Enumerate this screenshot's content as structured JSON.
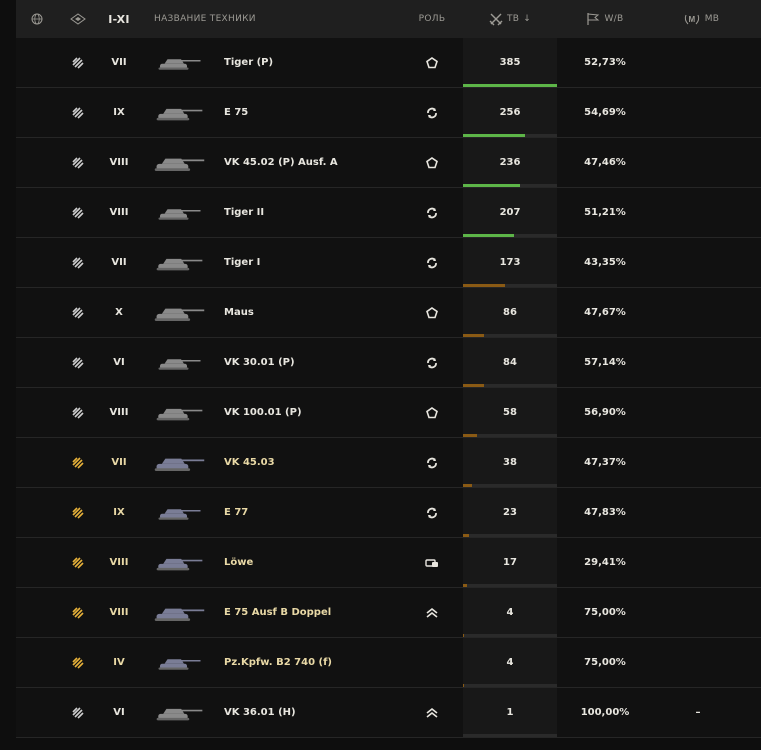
{
  "header": {
    "nation_icon": "globe-icon",
    "type_icon": "vehicle-type-icon",
    "tier_label": "I-XI",
    "name_label": "НАЗВАНИЕ ТЕХНИКИ",
    "role_label": "РОЛЬ",
    "battles_label": "ТВ",
    "sort_indicator": "↓",
    "winrate_label": "W/B",
    "mastery_label": "MB"
  },
  "colors": {
    "bar_green": "#5db548",
    "bar_orange": "#8a5a14",
    "premium_gold": "#e8b23a",
    "regular_chevron": "#cfcfcf"
  },
  "rows": [
    {
      "tier": "VII",
      "name": "Tiger (P)",
      "role": "pentagon-icon",
      "battles": "385",
      "winrate": "52,73%",
      "mb": "",
      "bar": 1.0,
      "bar_color": "green",
      "premium": false
    },
    {
      "tier": "IX",
      "name": "E 75",
      "role": "cycle-icon",
      "battles": "256",
      "winrate": "54,69%",
      "mb": "",
      "bar": 0.66,
      "bar_color": "green",
      "premium": false
    },
    {
      "tier": "VIII",
      "name": "VK 45.02 (P) Ausf. A",
      "role": "pentagon-icon",
      "battles": "236",
      "winrate": "47,46%",
      "mb": "",
      "bar": 0.61,
      "bar_color": "green",
      "premium": false
    },
    {
      "tier": "VIII",
      "name": "Tiger II",
      "role": "cycle-icon",
      "battles": "207",
      "winrate": "51,21%",
      "mb": "",
      "bar": 0.54,
      "bar_color": "green",
      "premium": false
    },
    {
      "tier": "VII",
      "name": "Tiger I",
      "role": "cycle-icon",
      "battles": "173",
      "winrate": "43,35%",
      "mb": "",
      "bar": 0.45,
      "bar_color": "orange",
      "premium": false
    },
    {
      "tier": "X",
      "name": "Maus",
      "role": "pentagon-icon",
      "battles": "86",
      "winrate": "47,67%",
      "mb": "",
      "bar": 0.22,
      "bar_color": "orange",
      "premium": false
    },
    {
      "tier": "VI",
      "name": "VK 30.01 (P)",
      "role": "cycle-icon",
      "battles": "84",
      "winrate": "57,14%",
      "mb": "",
      "bar": 0.22,
      "bar_color": "orange",
      "premium": false
    },
    {
      "tier": "VIII",
      "name": "VK 100.01 (P)",
      "role": "pentagon-icon",
      "battles": "58",
      "winrate": "56,90%",
      "mb": "",
      "bar": 0.15,
      "bar_color": "orange",
      "premium": false
    },
    {
      "tier": "VII",
      "name": "VK 45.03",
      "role": "cycle-icon",
      "battles": "38",
      "winrate": "47,37%",
      "mb": "",
      "bar": 0.1,
      "bar_color": "orange",
      "premium": true
    },
    {
      "tier": "IX",
      "name": "E 77",
      "role": "cycle-icon",
      "battles": "23",
      "winrate": "47,83%",
      "mb": "",
      "bar": 0.06,
      "bar_color": "orange",
      "premium": true
    },
    {
      "tier": "VIII",
      "name": "Löwe",
      "role": "shield-icon",
      "battles": "17",
      "winrate": "29,41%",
      "mb": "",
      "bar": 0.04,
      "bar_color": "orange",
      "premium": true
    },
    {
      "tier": "VIII",
      "name": "E 75 Ausf B Doppel",
      "role": "double-chevron-icon",
      "battles": "4",
      "winrate": "75,00%",
      "mb": "",
      "bar": 0.01,
      "bar_color": "orange",
      "premium": true
    },
    {
      "tier": "IV",
      "name": "Pz.Kpfw. B2 740 (f)",
      "role": "",
      "battles": "4",
      "winrate": "75,00%",
      "mb": "",
      "bar": 0.01,
      "bar_color": "orange",
      "premium": true
    },
    {
      "tier": "VI",
      "name": "VK 36.01 (H)",
      "role": "double-chevron-icon",
      "battles": "1",
      "winrate": "100,00%",
      "mb": "–",
      "bar": 0.0,
      "bar_color": "orange",
      "premium": false
    }
  ]
}
